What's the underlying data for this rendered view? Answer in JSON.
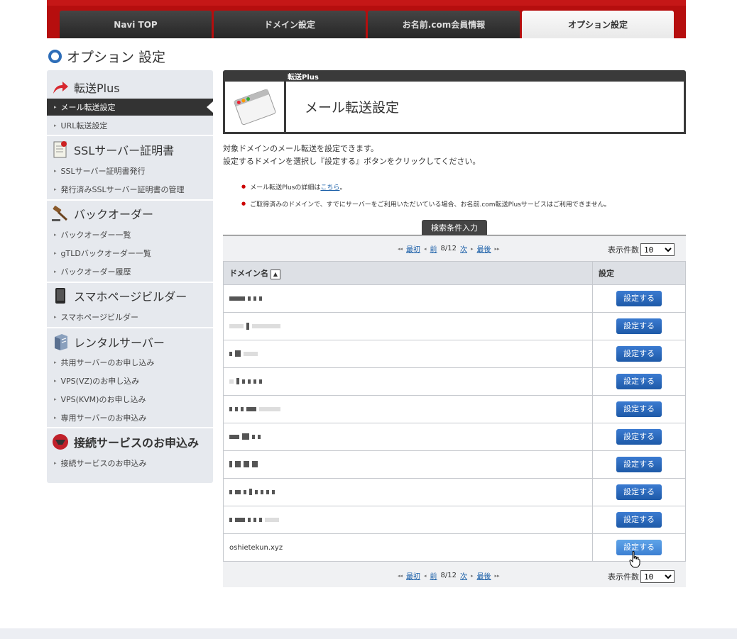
{
  "nav": {
    "tabs": [
      {
        "label": "Navi TOP"
      },
      {
        "label": "ドメイン設定"
      },
      {
        "label": "お名前.com会員情報"
      },
      {
        "label": "オプション設定"
      }
    ]
  },
  "page_title": "オプション 設定",
  "sidebar": {
    "sections": [
      {
        "title": "転送Plus",
        "items": [
          "メール転送設定",
          "URL転送設定"
        ]
      },
      {
        "title": "SSLサーバー証明書",
        "items": [
          "SSLサーバー証明書発行",
          "発行済みSSLサーバー証明書の管理"
        ]
      },
      {
        "title": "バックオーダー",
        "items": [
          "バックオーダー一覧",
          "gTLDバックオーダー一覧",
          "バックオーダー履歴"
        ]
      },
      {
        "title": "スマホページビルダー",
        "items": [
          "スマホページビルダー"
        ]
      },
      {
        "title": "レンタルサーバー",
        "items": [
          "共用サーバーのお申し込み",
          "VPS(VZ)のお申し込み",
          "VPS(KVM)のお申し込み",
          "専用サーバーのお申込み"
        ]
      },
      {
        "title": "接続サービスのお申込み",
        "items": [
          "接続サービスのお申込み"
        ]
      }
    ]
  },
  "header_box": {
    "category": "転送Plus",
    "title": "メール転送設定"
  },
  "description": {
    "line1": "対象ドメインのメール転送を設定できます。",
    "line2": "設定するドメインを選択し『設定する』ボタンをクリックしてください。"
  },
  "notes": {
    "note1_prefix": "メール転送Plusの詳細は",
    "note1_link": "こちら",
    "note1_suffix": "。",
    "note2": "ご取得済みのドメインで、すでにサーバーをご利用いただいている場合、お名前.com転送Plusサービスはご利用できません。"
  },
  "search_tab": "検索条件入力",
  "pager": {
    "first": "最初",
    "prev": "前",
    "page": "8/12",
    "next": "次",
    "last": "最後",
    "count_label": "表示件数",
    "count_value": "10"
  },
  "table": {
    "col_domain": "ドメイン名",
    "col_setting": "設定",
    "sort_icon": "▲",
    "button_label": "設定する",
    "last_domain": "oshietekun.xyz"
  }
}
